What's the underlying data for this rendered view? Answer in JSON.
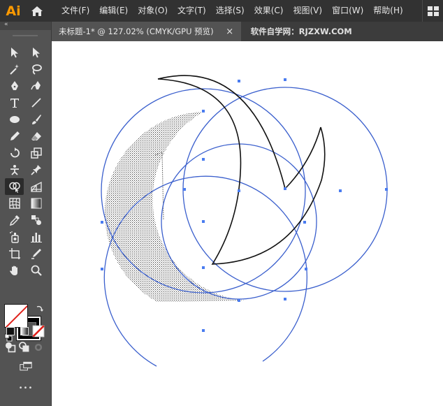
{
  "app": {
    "logo_text": "Ai",
    "logo_color": "#ff9a00"
  },
  "menu": {
    "items": [
      "文件(F)",
      "编辑(E)",
      "对象(O)",
      "文字(T)",
      "选择(S)",
      "效果(C)",
      "视图(V)",
      "窗口(W)",
      "帮助(H)"
    ]
  },
  "tabs": {
    "active_title": "未标题-1* @ 127.02% (CMYK/GPU 预览)",
    "close_glyph": "×",
    "watermark_title": "软件自学网：RJZXW.COM"
  },
  "toolbox": {
    "collapse_glyph": "«",
    "tools": [
      "selection-tool",
      "direct-selection-tool",
      "magic-wand-tool",
      "lasso-tool",
      "pen-tool",
      "curvature-tool",
      "type-tool",
      "line-segment-tool",
      "ellipse-tool",
      "paintbrush-tool",
      "shaper-tool",
      "eraser-tool",
      "rotate-tool",
      "scale-tool",
      "puppet-warp-tool",
      "pin-tool",
      "shape-builder-tool",
      "perspective-grid-tool",
      "mesh-tool",
      "gradient-tool",
      "eyedropper-tool",
      "blend-tool",
      "symbol-sprayer-tool",
      "column-graph-tool",
      "artboard-tool",
      "slice-tool",
      "hand-tool",
      "zoom-tool"
    ],
    "selected_tool": "shape-builder-tool",
    "more_glyph": "•••"
  },
  "colors": {
    "toolbar_bg": "#535353",
    "menubar_bg": "#323232",
    "selection_blue": "#3a5fcd",
    "anchor_blue": "#4a7cf0"
  }
}
